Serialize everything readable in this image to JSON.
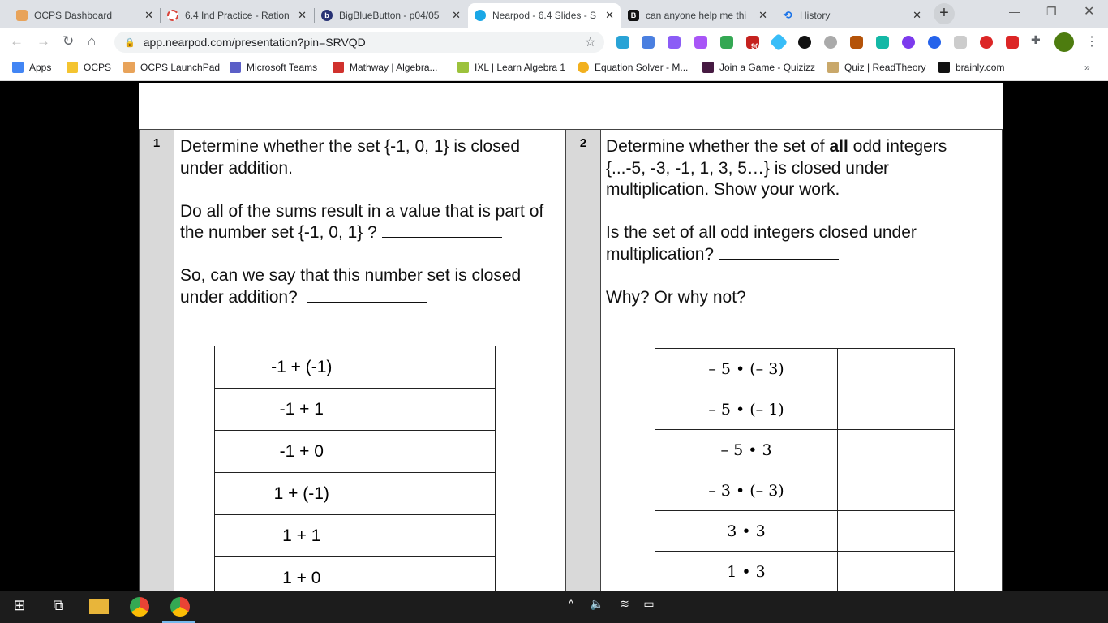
{
  "tabs": [
    {
      "title": "OCPS Dashboard",
      "color": "#e8a35a"
    },
    {
      "title": "6.4 Ind Practice - Ration",
      "color": "#d9443b"
    },
    {
      "title": "BigBlueButton - p04/05",
      "color": "#283274"
    },
    {
      "title": "Nearpod - 6.4 Slides - S",
      "color": "#1aa7e6"
    },
    {
      "title": "can anyone help me thi",
      "color": "#111111"
    },
    {
      "title": "History",
      "color": "#1a73e8"
    }
  ],
  "new_tab": "+",
  "address": "app.nearpod.com/presentation?pin=SRVQD",
  "extensions_badge": "90",
  "bookmarks": [
    {
      "label": "Apps",
      "color": "#4285f4"
    },
    {
      "label": "OCPS",
      "color": "#f4c430"
    },
    {
      "label": "OCPS LaunchPad",
      "color": "#e8a35a"
    },
    {
      "label": "Microsoft Teams",
      "color": "#5b5fc7"
    },
    {
      "label": "Mathway | Algebra...",
      "color": "#d0312d"
    },
    {
      "label": "IXL | Learn Algebra 1",
      "color": "#9cc23c"
    },
    {
      "label": "Equation Solver - M...",
      "color": "#f2b01e"
    },
    {
      "label": "Join a Game - Quizizz",
      "color": "#461a42"
    },
    {
      "label": "Quiz | ReadTheory",
      "color": "#c9a86a"
    },
    {
      "label": "brainly.com",
      "color": "#111111"
    }
  ],
  "q1": {
    "num": "1",
    "p1": "Determine whether the set {-1, 0, 1} is closed under addition.",
    "p2": "Do all of the sums result in a value that is part of the number set  {-1, 0, 1} ?",
    "p3": "So, can we say that this number set is closed under addition?",
    "rows": [
      "-1 + (-1)",
      "-1 + 1",
      "-1 + 0",
      "1 + (-1)",
      "1 + 1",
      "1 + 0"
    ]
  },
  "q2": {
    "num": "2",
    "p1a": "Determine whether the set of ",
    "p1b": "all",
    "p1c": " odd integers {...-5, -3, -1, 1, 3, 5…} is closed under multiplication. Show your work.",
    "p2": "Is the set of all odd integers closed under multiplication?",
    "p3": "Why?  Or why not?",
    "rows": [
      "– 5 • (– 3)",
      "– 5 • (– 1)",
      "– 5 • 3",
      "– 3 • (– 3)",
      "3 • 3",
      "1 • 3"
    ]
  }
}
